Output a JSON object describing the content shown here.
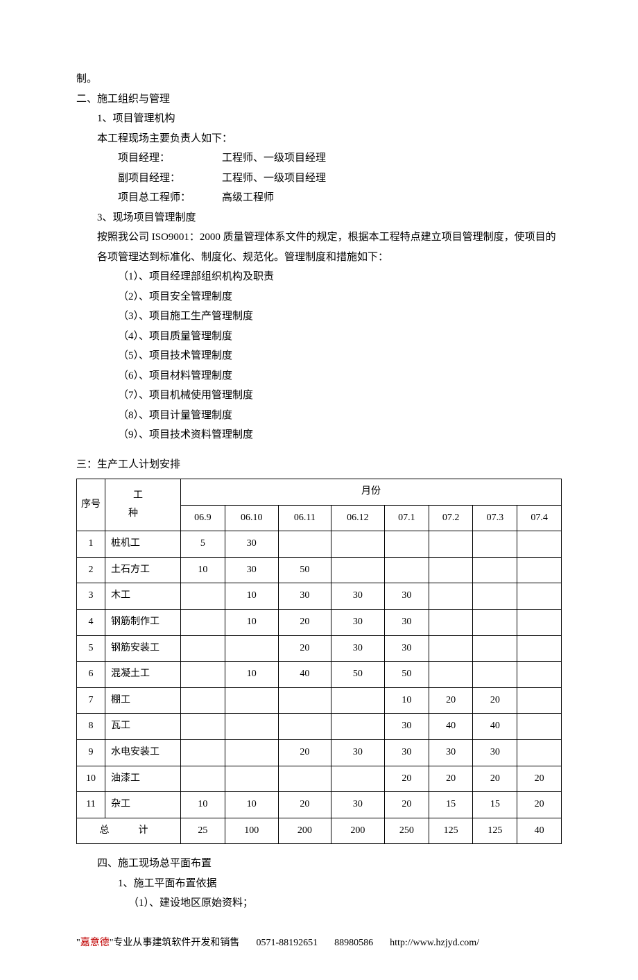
{
  "para0": "制。",
  "heading2": "二、施工组织与管理",
  "sub_1": "1、项目管理机构",
  "sub_1_desc": "本工程现场主要负责人如下：",
  "roles": [
    {
      "label": "项目经理：",
      "value": "工程师、一级项目经理"
    },
    {
      "label": "副项目经理：",
      "value": "工程师、一级项目经理"
    },
    {
      "label": "项目总工程师：",
      "value": "高级工程师"
    }
  ],
  "sub_3": "3、现场项目管理制度",
  "sub_3_desc": "按照我公司 ISO9001：2000 质量管理体系文件的规定，根据本工程特点建立项目管理制度，使项目的各项管理达到标准化、制度化、规范化。管理制度和措施如下：",
  "mgmt_items": [
    "（1）、项目经理部组织机构及职责",
    "（2）、项目安全管理制度",
    "（3）、项目施工生产管理制度",
    "（4）、项目质量管理制度",
    "（5）、项目技术管理制度",
    "（6）、项目材料管理制度",
    "（7）、项目机械使用管理制度",
    "（8）、项目计量管理制度",
    "（9）、项目技术资料管理制度"
  ],
  "heading3": "三：生产工人计划安排",
  "table": {
    "col_seq": "序号",
    "col_type": "工　种",
    "col_month": "月份",
    "months": [
      "06.9",
      "06.10",
      "06.11",
      "06.12",
      "07.1",
      "07.2",
      "07.3",
      "07.4"
    ],
    "rows": [
      {
        "n": "1",
        "type": "桩机工",
        "v": [
          "5",
          "30",
          "",
          "",
          "",
          "",
          "",
          ""
        ]
      },
      {
        "n": "2",
        "type": "土石方工",
        "v": [
          "10",
          "30",
          "50",
          "",
          "",
          "",
          "",
          ""
        ]
      },
      {
        "n": "3",
        "type": "木工",
        "v": [
          "",
          "10",
          "30",
          "30",
          "30",
          "",
          "",
          ""
        ]
      },
      {
        "n": "4",
        "type": "钢筋制作工",
        "v": [
          "",
          "10",
          "20",
          "30",
          "30",
          "",
          "",
          ""
        ]
      },
      {
        "n": "5",
        "type": "钢筋安装工",
        "v": [
          "",
          "",
          "20",
          "30",
          "30",
          "",
          "",
          ""
        ]
      },
      {
        "n": "6",
        "type": "混凝土工",
        "v": [
          "",
          "10",
          "40",
          "50",
          "50",
          "",
          "",
          ""
        ]
      },
      {
        "n": "7",
        "type": "棚工",
        "v": [
          "",
          "",
          "",
          "",
          "10",
          "20",
          "20",
          ""
        ]
      },
      {
        "n": "8",
        "type": "瓦工",
        "v": [
          "",
          "",
          "",
          "",
          "30",
          "40",
          "40",
          ""
        ]
      },
      {
        "n": "9",
        "type": "水电安装工",
        "v": [
          "",
          "",
          "20",
          "30",
          "30",
          "30",
          "30",
          ""
        ]
      },
      {
        "n": "10",
        "type": "油漆工",
        "v": [
          "",
          "",
          "",
          "",
          "20",
          "20",
          "20",
          "20"
        ]
      },
      {
        "n": "11",
        "type": "杂工",
        "v": [
          "10",
          "10",
          "20",
          "30",
          "20",
          "15",
          "15",
          "20"
        ]
      }
    ],
    "total_label": "总　计",
    "total": [
      "25",
      "100",
      "200",
      "200",
      "250",
      "125",
      "125",
      "40"
    ]
  },
  "heading4": "四、施工现场总平面布置",
  "sub4_1": "1、施工平面布置依据",
  "sub4_1_1": "（1）、建设地区原始资料；",
  "footer": {
    "quote_open": "\"",
    "brand": "嘉意德",
    "tail": "\"专业从事建筑软件开发和销售",
    "phone1": "0571-88192651",
    "phone2": "88980586",
    "url": "http://www.hzjyd.com/"
  }
}
